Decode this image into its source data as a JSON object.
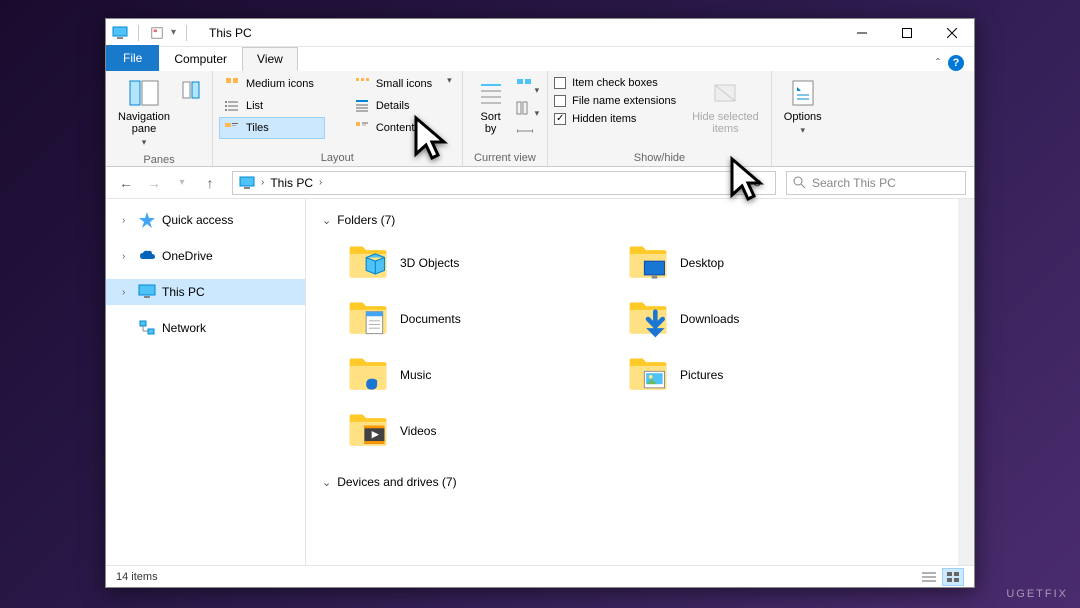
{
  "titlebar": {
    "title": "This PC"
  },
  "ribbon_tabs": {
    "file": "File",
    "computer": "Computer",
    "view": "View"
  },
  "ribbon": {
    "panes": {
      "nav_pane": "Navigation\npane",
      "label": "Panes"
    },
    "layout": {
      "label": "Layout",
      "col1": [
        "Medium icons",
        "List",
        "Tiles"
      ],
      "col2": [
        "Small icons",
        "Details",
        "Content"
      ]
    },
    "current_view": {
      "sort_by": "Sort\nby",
      "label": "Current view"
    },
    "show_hide": {
      "label": "Show/hide",
      "item_check_boxes": "Item check boxes",
      "file_ext": "File name extensions",
      "hidden_items": "Hidden items",
      "hide_selected": "Hide selected\nitems"
    },
    "options": {
      "label": "Options"
    }
  },
  "addressbar": {
    "crumb": "This PC",
    "search_placeholder": "Search This PC"
  },
  "sidebar": {
    "items": [
      {
        "label": "Quick access",
        "icon": "star"
      },
      {
        "label": "OneDrive",
        "icon": "cloud"
      },
      {
        "label": "This PC",
        "icon": "pc",
        "selected": true
      },
      {
        "label": "Network",
        "icon": "network"
      }
    ]
  },
  "content": {
    "folders_header": "Folders (7)",
    "folders": [
      {
        "label": "3D Objects",
        "overlay": "cube"
      },
      {
        "label": "Desktop",
        "overlay": "desktop"
      },
      {
        "label": "Documents",
        "overlay": "doc"
      },
      {
        "label": "Downloads",
        "overlay": "down"
      },
      {
        "label": "Music",
        "overlay": "music"
      },
      {
        "label": "Pictures",
        "overlay": "pic"
      },
      {
        "label": "Videos",
        "overlay": "video"
      }
    ],
    "drives_header": "Devices and drives (7)"
  },
  "statusbar": {
    "count": "14 items"
  },
  "watermark": "UGETFIX"
}
